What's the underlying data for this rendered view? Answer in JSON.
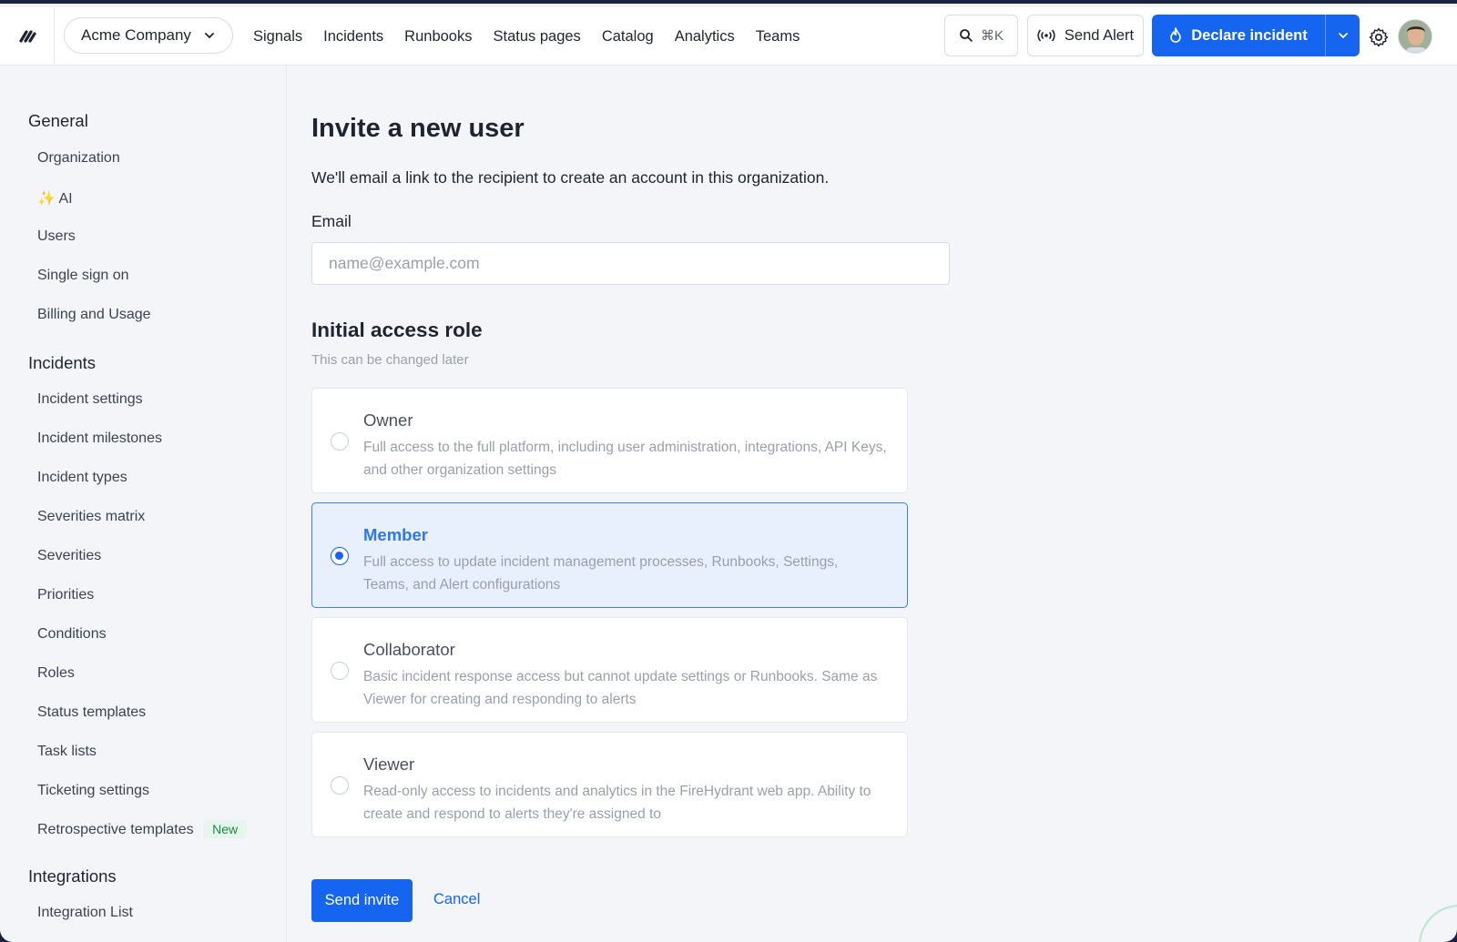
{
  "header": {
    "org_name": "Acme Company",
    "nav": [
      "Signals",
      "Incidents",
      "Runbooks",
      "Status pages",
      "Catalog",
      "Analytics",
      "Teams"
    ],
    "search_shortcut": "⌘K",
    "send_alert_label": "Send Alert",
    "declare_label": "Declare incident",
    "accent_color": "#1565f0"
  },
  "sidebar": {
    "sections": [
      {
        "title": "General",
        "items": [
          "Organization",
          "✨ AI",
          "Users",
          "Single sign on",
          "Billing and Usage"
        ]
      },
      {
        "title": "Incidents",
        "items": [
          "Incident settings",
          "Incident milestones",
          "Incident types",
          "Severities matrix",
          "Severities",
          "Priorities",
          "Conditions",
          "Roles",
          "Status templates",
          "Task lists",
          "Ticketing settings",
          "Retrospective templates"
        ],
        "badge_new": "New"
      },
      {
        "title": "Integrations",
        "items": [
          "Integration List"
        ]
      }
    ]
  },
  "main": {
    "title": "Invite a new user",
    "description": "We'll email a link to the recipient to create an account in this organization.",
    "email_label": "Email",
    "email_placeholder": "name@example.com",
    "email_value": "",
    "role_title": "Initial access role",
    "role_subtitle": "This can be changed later",
    "roles": [
      {
        "name": "Owner",
        "desc": "Full access to the full platform, including user administration, integrations, API Keys, and other organization settings",
        "selected": false
      },
      {
        "name": "Member",
        "desc": "Full access to update incident management processes, Runbooks, Settings, Teams, and Alert configurations",
        "selected": true
      },
      {
        "name": "Collaborator",
        "desc": "Basic incident response access but cannot update settings or Runbooks. Same as Viewer for creating and responding to alerts",
        "selected": false
      },
      {
        "name": "Viewer",
        "desc": "Read-only access to incidents and analytics in the FireHydrant web app. Ability to create and respond to alerts they're assigned to",
        "selected": false
      }
    ],
    "send_label": "Send invite",
    "cancel_label": "Cancel"
  }
}
